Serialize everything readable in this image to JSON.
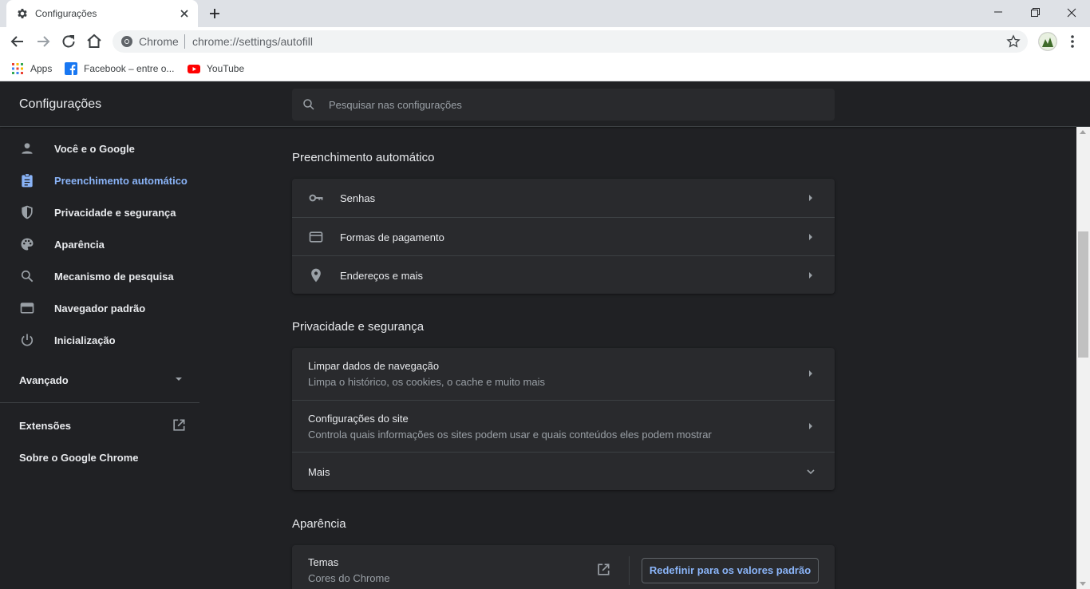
{
  "browser": {
    "tab_title": "Configurações",
    "omnibox_label": "Chrome",
    "url": "chrome://settings/autofill",
    "bookmarks": [
      {
        "label": "Apps"
      },
      {
        "label": "Facebook – entre o..."
      },
      {
        "label": "YouTube"
      }
    ]
  },
  "settings": {
    "title": "Configurações",
    "search_placeholder": "Pesquisar nas configurações",
    "nav": [
      {
        "label": "Você e o Google",
        "icon": "person-icon"
      },
      {
        "label": "Preenchimento automático",
        "icon": "clipboard-icon",
        "active": true
      },
      {
        "label": "Privacidade e segurança",
        "icon": "shield-icon"
      },
      {
        "label": "Aparência",
        "icon": "palette-icon"
      },
      {
        "label": "Mecanismo de pesquisa",
        "icon": "search-icon"
      },
      {
        "label": "Navegador padrão",
        "icon": "browser-window-icon"
      },
      {
        "label": "Inicialização",
        "icon": "power-icon"
      }
    ],
    "advanced_label": "Avançado",
    "extensions_label": "Extensões",
    "about_label": "Sobre o Google Chrome",
    "sections": {
      "autofill": {
        "title": "Preenchimento automático",
        "rows": [
          {
            "label": "Senhas",
            "icon": "key-icon"
          },
          {
            "label": "Formas de pagamento",
            "icon": "credit-card-icon"
          },
          {
            "label": "Endereços e mais",
            "icon": "location-pin-icon"
          }
        ]
      },
      "privacy": {
        "title": "Privacidade e segurança",
        "rows": [
          {
            "title": "Limpar dados de navegação",
            "subtitle": "Limpa o histórico, os cookies, o cache e muito mais"
          },
          {
            "title": "Configurações do site",
            "subtitle": "Controla quais informações os sites podem usar e quais conteúdos eles podem mostrar"
          },
          {
            "title": "Mais"
          }
        ]
      },
      "appearance": {
        "title": "Aparência",
        "themes_title": "Temas",
        "themes_subtitle": "Cores do Chrome",
        "reset_button": "Redefinir para os valores padrão"
      }
    }
  },
  "colors": {
    "background": "#202124",
    "card": "#292a2d",
    "accent": "#8ab4f8",
    "text": "#e8eaed",
    "secondary_text": "#9aa0a6"
  }
}
